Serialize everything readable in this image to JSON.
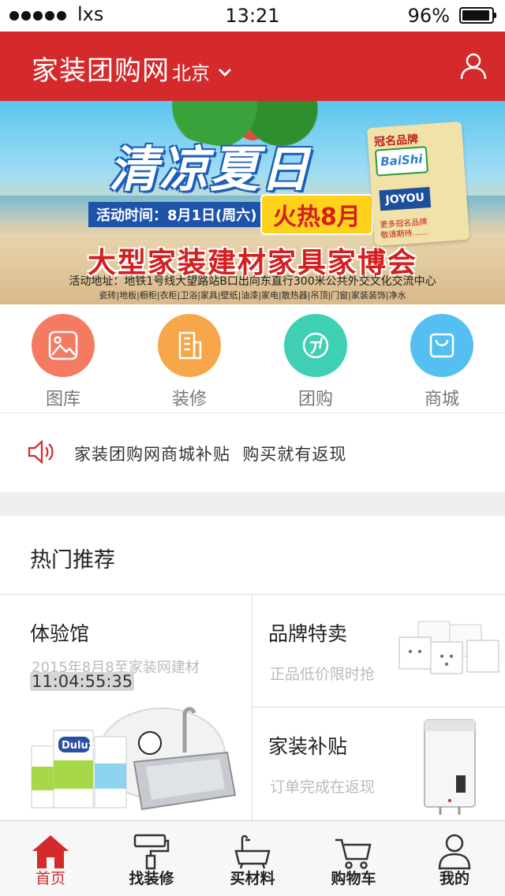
{
  "status_bar": {
    "carrier": "lxs",
    "time": "13:21",
    "battery": "96%"
  },
  "header": {
    "title": "家装团购网",
    "city": "北京",
    "colors": {
      "brand": "#d42a2b"
    }
  },
  "banner": {
    "headline": "清凉夏日",
    "date": "活动时间：8月1日(周六)",
    "hot": "火热8月",
    "expo": "大型家装建材家具家博会",
    "address": "活动地址：地铁1号线大望路站B口出向东直行300米公共外交文化交流中心",
    "categories": "瓷砖|地板|橱柜|衣柜|卫浴|家具|壁纸|油漆|家电|散热器|吊顶|门窗|家装装饰|净水",
    "tag": {
      "brand": "冠名品牌",
      "baishi": "BaiShi",
      "joyou": "JOYOU",
      "more": "更多冠名品牌\n敬请期待……"
    }
  },
  "quick_nav": [
    {
      "label": "图库",
      "icon": "gallery-icon",
      "color": "#f57a62"
    },
    {
      "label": "装修",
      "icon": "building-icon",
      "color": "#f7a64a"
    },
    {
      "label": "团购",
      "icon": "group-buy-icon",
      "color": "#3fcfb3"
    },
    {
      "label": "商城",
      "icon": "shopping-bag-icon",
      "color": "#54bff0"
    }
  ],
  "notice": {
    "text": "家装团购网商城补贴  购买就有返现"
  },
  "hot": {
    "title": "热门推荐",
    "experience": {
      "title": "体验馆",
      "desc": "2015年8月8至家装网建材",
      "countdown": "11:04:55:35"
    },
    "brand_sale": {
      "title": "品牌特卖",
      "sub": "正品低价限时抢"
    },
    "subsidy": {
      "title": "家装补贴",
      "sub": "订单完成在返现"
    }
  },
  "tabs": [
    {
      "label": "首页",
      "icon": "home-icon",
      "active": true
    },
    {
      "label": "找装修",
      "icon": "paint-roller-icon",
      "active": false
    },
    {
      "label": "买材料",
      "icon": "bathtub-icon",
      "active": false
    },
    {
      "label": "购物车",
      "icon": "cart-icon",
      "active": false
    },
    {
      "label": "我的",
      "icon": "profile-icon",
      "active": false
    }
  ]
}
